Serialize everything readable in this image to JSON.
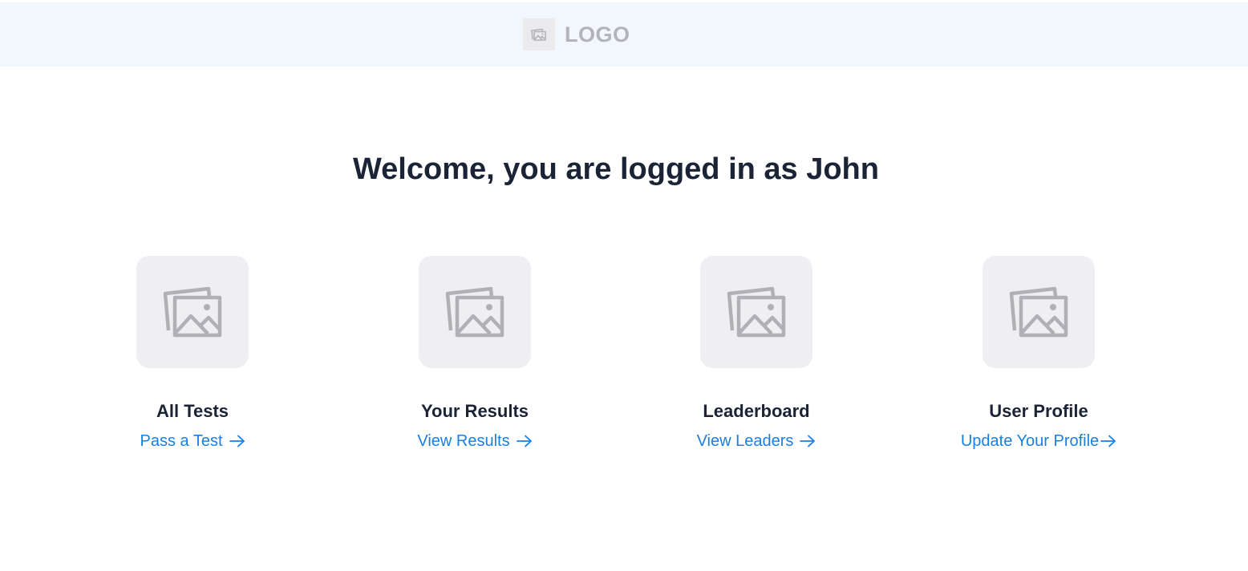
{
  "header": {
    "logo_icon": "image-icon",
    "logo_text": "LOGO",
    "background": "#f2f7fe"
  },
  "main": {
    "welcome": "Welcome, you are logged in as John"
  },
  "cards": [
    {
      "icon": "image-gallery-icon",
      "title": "All Tests",
      "link": "Pass a Test"
    },
    {
      "icon": "image-gallery-icon",
      "title": "Your Results",
      "link": "View Results"
    },
    {
      "icon": "image-gallery-icon",
      "title": "Leaderboard",
      "link": "View Leaders"
    },
    {
      "icon": "image-gallery-icon",
      "title": "User Profile",
      "link": "Update Your Profile"
    }
  ],
  "colors": {
    "heading": "#1b2336",
    "link": "#1a7fe0",
    "placeholder_bg": "#efeff3",
    "placeholder_icon": "#b0b0b6"
  }
}
